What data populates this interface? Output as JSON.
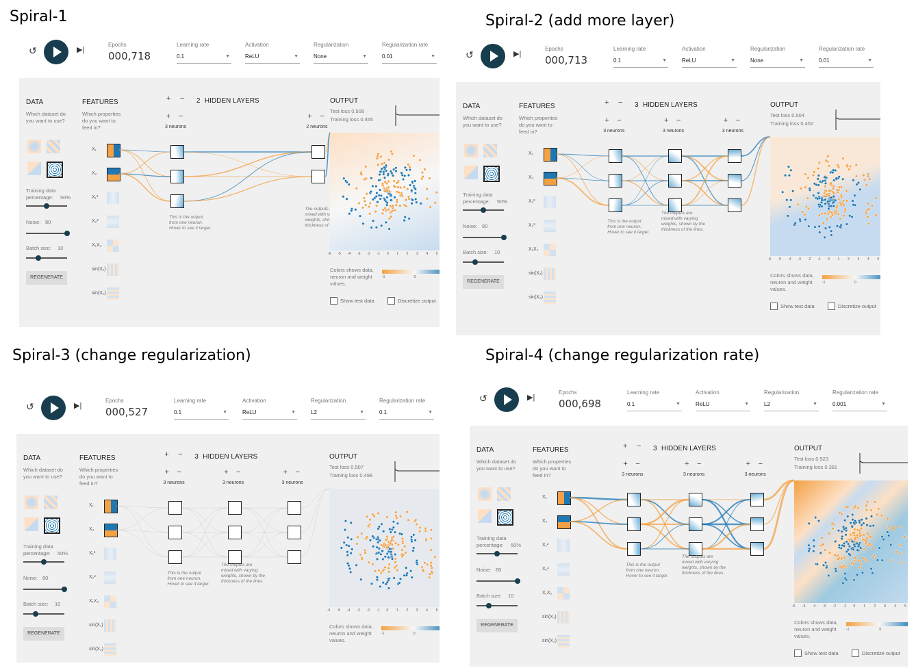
{
  "headings": [
    "Spiral-1",
    "Spiral-2 (add more layer)",
    "Spiral-3 (change regularization)",
    "Spiral-4 (change regularization rate)"
  ],
  "labels": {
    "epochs": "Epochs",
    "learning_rate": "Learning rate",
    "activation": "Activation",
    "regularization": "Regularization",
    "regularization_rate": "Regularization rate",
    "data": "DATA",
    "data_q": "Which dataset do you want to use?",
    "features": "FEATURES",
    "features_q": "Which properties do you want to feed in?",
    "hidden_layers": "HIDDEN LAYERS",
    "output": "OUTPUT",
    "training_pct": "Training data percentage:",
    "noise": "Noise:",
    "batch": "Batch size:",
    "regenerate": "REGENERATE",
    "neuron_note": "This is the output from one neuron. Hover to see it larger.",
    "weights_note": "The outputs are mixed with varying weights, shown by the thickness of the lines.",
    "colors_note": "Colors shows data, neuron and weight values.",
    "legend_ticks": [
      "-1",
      "0",
      "1"
    ],
    "show_test": "Show test data",
    "discretize": "Discretize output",
    "feature_names": [
      "X₁",
      "X₂",
      "X₁²",
      "X₂²",
      "X₁X₂",
      "sin(X₁)",
      "sin(X₂)"
    ],
    "axis_ticks": [
      "-6",
      "-5",
      "-4",
      "-3",
      "-2",
      "-1",
      "0",
      "1",
      "2",
      "3",
      "4",
      "5",
      "6"
    ]
  },
  "colors": {
    "orange": "#f4a144",
    "blue": "#1f78b4",
    "dark": "#183d4e",
    "bg": "#f0f0f0"
  },
  "panels": [
    {
      "epochs": "000,718",
      "learning_rate": "0.1",
      "activation": "ReLU",
      "regularization": "None",
      "reg_rate": "0.01",
      "layers": 2,
      "neurons": [
        3,
        2
      ],
      "neurons_labels": [
        "3 neurons",
        "2 neurons"
      ],
      "test_loss": "Test loss 0.508",
      "train_loss": "Training loss 0.465",
      "training_pct": "50%",
      "noise": "80",
      "batch": "10"
    },
    {
      "epochs": "000,713",
      "learning_rate": "0.1",
      "activation": "ReLU",
      "regularization": "None",
      "reg_rate": "0.01",
      "layers": 3,
      "neurons": [
        3,
        3,
        3
      ],
      "neurons_labels": [
        "3 neurons",
        "3 neurons",
        "3 neurons"
      ],
      "test_loss": "Test loss 0.504",
      "train_loss": "Training loss 0.452",
      "training_pct": "50%",
      "noise": "80",
      "batch": "10"
    },
    {
      "epochs": "000,527",
      "learning_rate": "0.1",
      "activation": "ReLU",
      "regularization": "L2",
      "reg_rate": "0.1",
      "layers": 3,
      "neurons": [
        3,
        3,
        3
      ],
      "neurons_labels": [
        "3 neurons",
        "3 neurons",
        "3 neurons"
      ],
      "test_loss": "Test loss 0.507",
      "train_loss": "Training loss 0.498",
      "training_pct": "50%",
      "noise": "80",
      "batch": "10"
    },
    {
      "epochs": "000,698",
      "learning_rate": "0.1",
      "activation": "ReLU",
      "regularization": "L2",
      "reg_rate": "0.001",
      "layers": 3,
      "neurons": [
        3,
        3,
        3
      ],
      "neurons_labels": [
        "3 neurons",
        "3 neurons",
        "3 neurons"
      ],
      "test_loss": "Test loss 0.523",
      "train_loss": "Training loss 0.381",
      "training_pct": "50%",
      "noise": "80",
      "batch": "10"
    }
  ]
}
